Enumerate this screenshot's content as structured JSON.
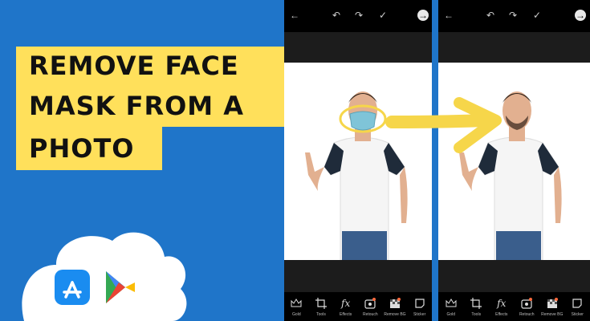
{
  "thumbnail": {
    "headline_lines": [
      "REMOVE FACE",
      "MASK FROM A",
      "PHOTO"
    ],
    "colors": {
      "background_blue": "#1f75c9",
      "headline_yellow": "#ffe05b",
      "arrow_yellow": "#f6d64a",
      "cloud_white": "#ffffff"
    }
  },
  "badges": [
    {
      "name": "app-store-icon",
      "color": "#1a8cf0"
    },
    {
      "name": "google-play-icon",
      "color": "#34a853"
    }
  ],
  "editor": {
    "topbar_icons": [
      "back-arrow-icon",
      "undo-icon",
      "redo-icon",
      "checkmark-icon",
      "next-arrow-icon"
    ],
    "tools": [
      {
        "label": "Gold",
        "icon": "crown-icon"
      },
      {
        "label": "Tools",
        "icon": "crop-icon"
      },
      {
        "label": "Effects",
        "icon": "fx-icon"
      },
      {
        "label": "Retouch",
        "icon": "retouch-icon"
      },
      {
        "label": "Remove BG",
        "icon": "remove-bg-icon"
      },
      {
        "label": "Sticker",
        "icon": "sticker-icon"
      }
    ]
  }
}
